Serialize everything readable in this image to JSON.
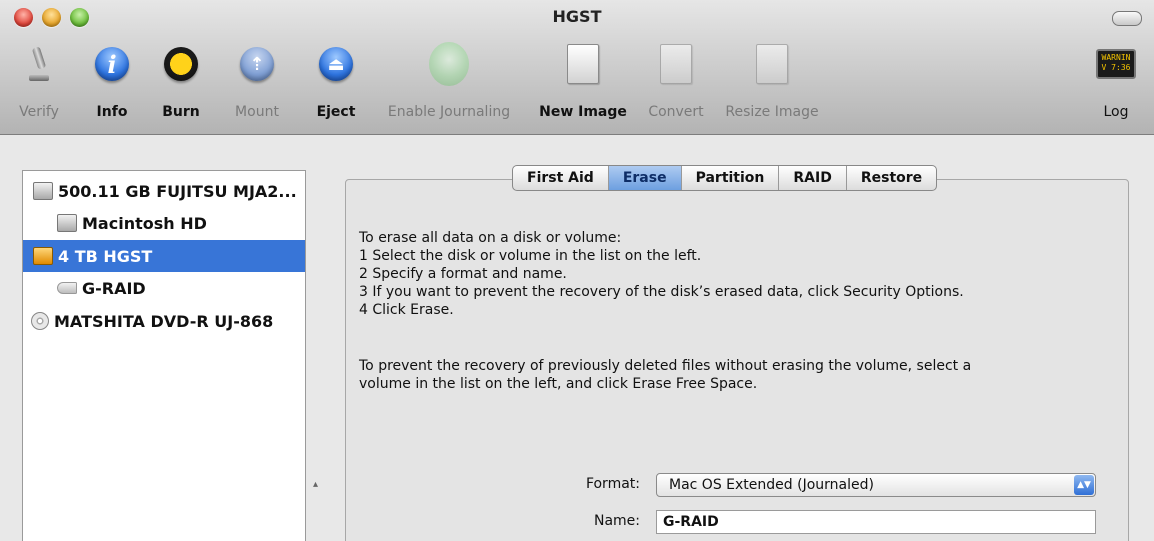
{
  "window": {
    "title": "HGST"
  },
  "toolbar": {
    "items": [
      {
        "label": "Verify",
        "icon": "microscope-icon",
        "enabled": false
      },
      {
        "label": "Info",
        "icon": "info-icon",
        "enabled": true
      },
      {
        "label": "Burn",
        "icon": "burn-icon",
        "enabled": true
      },
      {
        "label": "Mount",
        "icon": "mount-icon",
        "enabled": false
      },
      {
        "label": "Eject",
        "icon": "eject-icon",
        "enabled": true
      },
      {
        "label": "Enable Journaling",
        "icon": "journaling-icon",
        "enabled": false
      },
      {
        "label": "New Image",
        "icon": "new-image-icon",
        "enabled": true
      },
      {
        "label": "Convert",
        "icon": "convert-icon",
        "enabled": false
      },
      {
        "label": "Resize Image",
        "icon": "resize-image-icon",
        "enabled": false
      },
      {
        "label": "Log",
        "icon": "log-icon",
        "enabled": true
      }
    ],
    "log_icon_text": [
      "WARNIN",
      "V 7:36"
    ]
  },
  "sidebar": {
    "items": [
      {
        "label": "500.11 GB FUJITSU MJA2...",
        "icon": "hard-disk-icon"
      },
      {
        "label": "Macintosh HD",
        "icon": "volume-icon"
      },
      {
        "label": "4 TB HGST",
        "icon": "external-disk-icon",
        "selected": true
      },
      {
        "label": "G-RAID",
        "icon": "volume-icon"
      },
      {
        "label": "MATSHITA DVD-R UJ-868",
        "icon": "optical-drive-icon"
      }
    ]
  },
  "tabs": [
    {
      "label": "First Aid"
    },
    {
      "label": "Erase",
      "active": true
    },
    {
      "label": "Partition"
    },
    {
      "label": "RAID"
    },
    {
      "label": "Restore"
    }
  ],
  "erase": {
    "intro": "To erase all data on a disk or volume:",
    "steps": [
      "1 Select the disk or volume in the list on the left.",
      "2 Specify a format and name.",
      "3 If you want to prevent the recovery of the disk’s erased data, click Security Options.",
      "4 Click Erase."
    ],
    "free_space_1": "To prevent the recovery of previously deleted files without erasing the volume, select a",
    "free_space_2": "volume in the list on the left, and click Erase Free Space.",
    "format_label": "Format:",
    "format_value": "Mac OS Extended (Journaled)",
    "name_label": "Name:",
    "name_value": "G-RAID"
  },
  "colors": {
    "selection": "#3875d7",
    "active_tab": "#6d9fe0"
  }
}
